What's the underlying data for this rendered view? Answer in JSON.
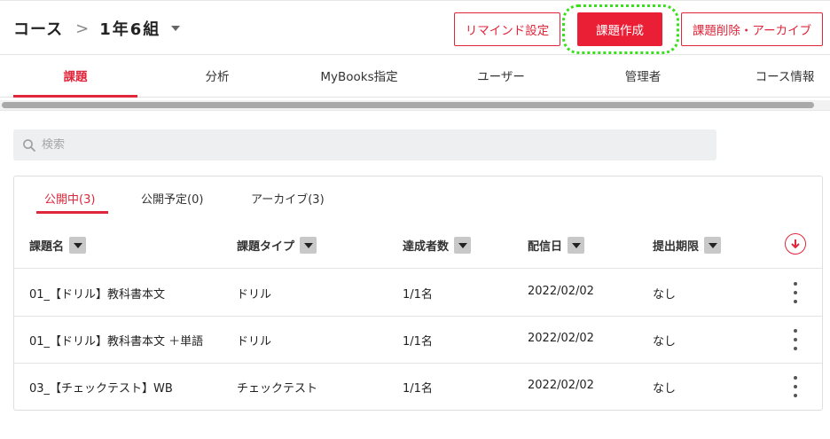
{
  "header": {
    "course_label": "コース",
    "separator": ">",
    "class_name": "1年6組",
    "buttons": {
      "remind": "リマインド設定",
      "create": "課題作成",
      "archive": "課題削除・アーカイブ"
    }
  },
  "nav_tabs": [
    {
      "label": "課題",
      "active": true
    },
    {
      "label": "分析",
      "active": false
    },
    {
      "label": "MyBooks指定",
      "active": false
    },
    {
      "label": "ユーザー",
      "active": false
    },
    {
      "label": "管理者",
      "active": false
    },
    {
      "label": "コース情報",
      "active": false
    }
  ],
  "search": {
    "placeholder": "検索",
    "icon": "search-icon"
  },
  "sub_tabs": [
    {
      "label": "公開中(3)",
      "active": true
    },
    {
      "label": "公開予定(0)",
      "active": false
    },
    {
      "label": "アーカイブ(3)",
      "active": false
    }
  ],
  "table": {
    "columns": [
      "課題名",
      "課題タイプ",
      "達成者数",
      "配信日",
      "提出期限"
    ],
    "rows": [
      {
        "name": "01_【ドリル】教科書本文",
        "type": "ドリル",
        "achievers": "1/1名",
        "date": "2022/02/02",
        "deadline": "なし"
      },
      {
        "name": "01_【ドリル】教科書本文 ＋単語",
        "type": "ドリル",
        "achievers": "1/1名",
        "date": "2022/02/02",
        "deadline": "なし"
      },
      {
        "name": "03_【チェックテスト】WB",
        "type": "チェックテスト",
        "achievers": "1/1名",
        "date": "2022/02/02",
        "deadline": "なし"
      }
    ]
  },
  "colors": {
    "accent": "#e0263a",
    "highlight": "#38e01c"
  }
}
